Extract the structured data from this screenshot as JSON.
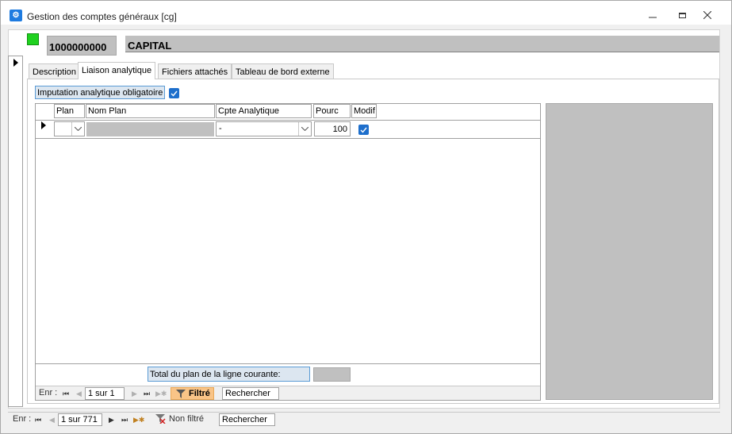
{
  "window": {
    "title": "Gestion des comptes généraux [cg]",
    "controls": [
      "minimize",
      "maximize",
      "close"
    ]
  },
  "record": {
    "code": "1000000000",
    "name": "CAPITAL",
    "status_color": "#1fd11f"
  },
  "tabs": [
    {
      "label": "Description",
      "active": false
    },
    {
      "label": "Liaison analytique",
      "active": true
    },
    {
      "label": "Fichiers attachés",
      "active": false
    },
    {
      "label": "Tableau de bord externe",
      "active": false
    }
  ],
  "liaison": {
    "imputation_label": "Imputation analytique obligatoire",
    "imputation_checked": true
  },
  "grid": {
    "columns": [
      "Plan",
      "Nom Plan",
      "Cpte Analytique",
      "Pourc",
      "Modif"
    ],
    "rows": [
      {
        "plan": "",
        "nom_plan": "",
        "cpte_analytique": "-",
        "pourc": "100",
        "modif": true
      }
    ],
    "total_label": "Total du plan de la ligne courante:",
    "total_value": ""
  },
  "subform_nav": {
    "label": "Enr :",
    "position": "1 sur 1",
    "filter_label": "Filtré",
    "search_label": "Rechercher"
  },
  "form_nav": {
    "label": "Enr :",
    "position": "1 sur 771",
    "filter_label": "Non filtré",
    "search_label": "Rechercher"
  }
}
